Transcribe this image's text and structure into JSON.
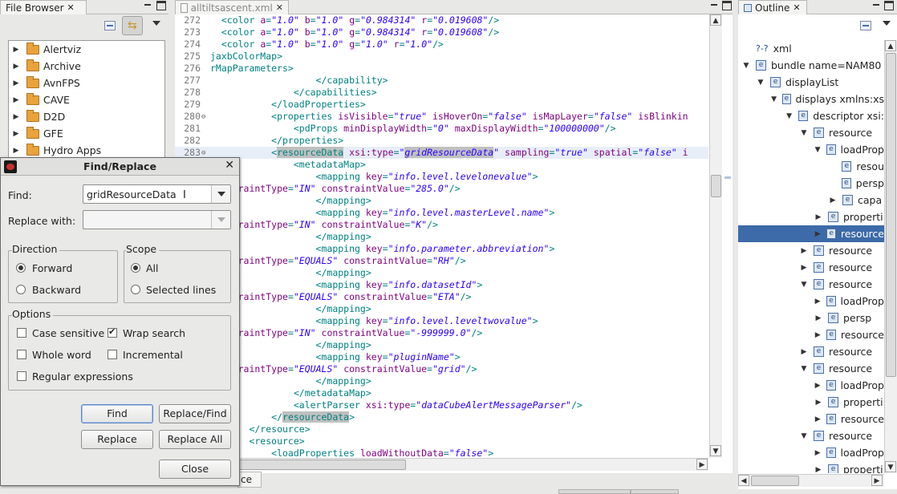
{
  "file_browser": {
    "tab_label": "File Browser",
    "items": [
      {
        "label": "Alertviz"
      },
      {
        "label": "Archive"
      },
      {
        "label": "AvnFPS"
      },
      {
        "label": "CAVE"
      },
      {
        "label": "D2D"
      },
      {
        "label": "GFE"
      },
      {
        "label": "Hydro Apps"
      }
    ]
  },
  "editor": {
    "tab_label": "alltiltsascent.xml",
    "lines": [
      {
        "n": "272",
        "html": "  &lt;color <span class='at'>a</span>=<span class='vl'>\"1.0\"</span> <span class='at'>b</span>=<span class='vl'>\"1.0\"</span> <span class='at'>g</span>=<span class='vl'>\"0.984314\"</span> <span class='at'>r</span>=<span class='vl'>\"0.019608\"</span>/&gt;"
      },
      {
        "n": "273",
        "html": "  &lt;color <span class='at'>a</span>=<span class='vl'>\"1.0\"</span> <span class='at'>b</span>=<span class='vl'>\"1.0\"</span> <span class='at'>g</span>=<span class='vl'>\"0.984314\"</span> <span class='at'>r</span>=<span class='vl'>\"0.019608\"</span>/&gt;"
      },
      {
        "n": "274",
        "html": "  &lt;color <span class='at'>a</span>=<span class='vl'>\"1.0\"</span> <span class='at'>b</span>=<span class='vl'>\"1.0\"</span> <span class='at'>g</span>=<span class='vl'>\"1.0\"</span> <span class='at'>r</span>=<span class='vl'>\"1.0\"</span>/&gt;"
      },
      {
        "n": "275",
        "html": "jaxbColorMap&gt;"
      },
      {
        "n": "276",
        "html": "rMapParameters&gt;"
      },
      {
        "n": "277",
        "html": "                   &lt;/capability&gt;"
      },
      {
        "n": "278",
        "html": "               &lt;/capabilities&gt;"
      },
      {
        "n": "279",
        "html": "           &lt;/loadProperties&gt;"
      },
      {
        "n": "280",
        "html": "           &lt;properties <span class='at'>isVisible</span>=<span class='vl'>\"true\"</span> <span class='at'>isHoverOn</span>=<span class='vl'>\"false\"</span> <span class='at'>isMapLayer</span>=<span class='vl'>\"false\"</span> <span class='at'>isBlinkin</span>"
      },
      {
        "n": "281",
        "html": "               &lt;pdProps <span class='at'>minDisplayWidth</span>=<span class='vl'>\"0\"</span> <span class='at'>maxDisplayWidth</span>=<span class='vl'>\"100000000\"</span>/&gt;"
      },
      {
        "n": "282",
        "html": "           &lt;/properties&gt;"
      },
      {
        "n": "283",
        "html": "           &lt;<span class='hl'>resourceData</span> <span class='at'>xsi:type</span>=<span class='vl'>\"<span class='hl'>gridResourceData</span>\"</span> <span class='at'>sampling</span>=<span class='vl'>\"true\"</span> <span class='at'>spatial</span>=<span class='vl'>\"false\"</span> <span class='at'>i</span>"
      },
      {
        "n": "",
        "html": "               &lt;metadataMap&gt;"
      },
      {
        "n": "",
        "html": "                   &lt;mapping <span class='at'>key</span>=<span class='vl'>\"info.level.levelonevalue\"</span>&gt;"
      },
      {
        "n": "",
        "html": "<span class='at'>constraintType</span>=<span class='vl'>\"IN\"</span> <span class='at'>constraintValue</span>=<span class='vl'>\"285.0\"</span>/&gt;"
      },
      {
        "n": "",
        "html": "                   &lt;/mapping&gt;"
      },
      {
        "n": "",
        "html": "                   &lt;mapping <span class='at'>key</span>=<span class='vl'>\"info.level.masterLevel.name\"</span>&gt;"
      },
      {
        "n": "",
        "html": "<span class='at'>constraintType</span>=<span class='vl'>\"IN\"</span> <span class='at'>constraintValue</span>=<span class='vl'>\"K\"</span>/&gt;"
      },
      {
        "n": "",
        "html": "                   &lt;/mapping&gt;"
      },
      {
        "n": "",
        "html": "                   &lt;mapping <span class='at'>key</span>=<span class='vl'>\"info.parameter.abbreviation\"</span>&gt;"
      },
      {
        "n": "",
        "html": "<span class='at'>constraintType</span>=<span class='vl'>\"EQUALS\"</span> <span class='at'>constraintValue</span>=<span class='vl'>\"RH\"</span>/&gt;"
      },
      {
        "n": "",
        "html": "                   &lt;/mapping&gt;"
      },
      {
        "n": "",
        "html": "                   &lt;mapping <span class='at'>key</span>=<span class='vl'>\"info.datasetId\"</span>&gt;"
      },
      {
        "n": "",
        "html": "<span class='at'>constraintType</span>=<span class='vl'>\"EQUALS\"</span> <span class='at'>constraintValue</span>=<span class='vl'>\"ETA\"</span>/&gt;"
      },
      {
        "n": "",
        "html": "                   &lt;/mapping&gt;"
      },
      {
        "n": "",
        "html": "                   &lt;mapping <span class='at'>key</span>=<span class='vl'>\"info.level.leveltwovalue\"</span>&gt;"
      },
      {
        "n": "",
        "html": "<span class='at'>constraintType</span>=<span class='vl'>\"IN\"</span> <span class='at'>constraintValue</span>=<span class='vl'>\"-999999.0\"</span>/&gt;"
      },
      {
        "n": "",
        "html": "                   &lt;/mapping&gt;"
      },
      {
        "n": "",
        "html": "                   &lt;mapping <span class='at'>key</span>=<span class='vl'>\"pluginName\"</span>&gt;"
      },
      {
        "n": "",
        "html": "<span class='at'>constraintType</span>=<span class='vl'>\"EQUALS\"</span> <span class='at'>constraintValue</span>=<span class='vl'>\"grid\"</span>/&gt;"
      },
      {
        "n": "",
        "html": "                   &lt;/mapping&gt;"
      },
      {
        "n": "",
        "html": "               &lt;/metadataMap&gt;"
      },
      {
        "n": "",
        "html": "               &lt;alertParser <span class='at'>xsi:type</span>=<span class='vl'>\"dataCubeAlertMessageParser\"</span>/&gt;"
      },
      {
        "n": "",
        "html": "           &lt;/<span class='hl'>resourceData</span>&gt;"
      },
      {
        "n": "",
        "html": "       &lt;/resource&gt;"
      },
      {
        "n": "",
        "html": "       &lt;resource&gt;"
      },
      {
        "n": "",
        "html": "           &lt;loadProperties <span class='at'>loadWithoutData</span>=<span class='vl'>\"false\"</span>&gt;"
      }
    ],
    "bottom_tab_fragment": "ce"
  },
  "outline": {
    "tab_label": "Outline",
    "items": [
      {
        "label": "xml",
        "depth": 0,
        "arrow": "",
        "icon": "?-?"
      },
      {
        "label": "bundle name=NAM80",
        "depth": 0,
        "arrow": "▼",
        "icon": "e"
      },
      {
        "label": "displayList",
        "depth": 1,
        "arrow": "▼",
        "icon": "e"
      },
      {
        "label": "displays xmlns:xs",
        "depth": 2,
        "arrow": "▼",
        "icon": "e"
      },
      {
        "label": "descriptor xsi:",
        "depth": 3,
        "arrow": "▼",
        "icon": "e"
      },
      {
        "label": "resource",
        "depth": 4,
        "arrow": "▼",
        "icon": "e"
      },
      {
        "label": "loadProp",
        "depth": 5,
        "arrow": "▼",
        "icon": "e"
      },
      {
        "label": "resou",
        "depth": 6,
        "arrow": "",
        "icon": "e"
      },
      {
        "label": "persp",
        "depth": 6,
        "arrow": "",
        "icon": "e"
      },
      {
        "label": "capa",
        "depth": 6,
        "arrow": "▶",
        "icon": "e"
      },
      {
        "label": "properti",
        "depth": 5,
        "arrow": "▶",
        "icon": "e"
      },
      {
        "label": "resource",
        "depth": 5,
        "arrow": "▶",
        "icon": "e",
        "selected": true
      },
      {
        "label": "resource",
        "depth": 4,
        "arrow": "▶",
        "icon": "e"
      },
      {
        "label": "resource",
        "depth": 4,
        "arrow": "▶",
        "icon": "e"
      },
      {
        "label": "resource",
        "depth": 4,
        "arrow": "▼",
        "icon": "e"
      },
      {
        "label": "loadProp",
        "depth": 5,
        "arrow": "▶",
        "icon": "e"
      },
      {
        "label": "persp",
        "depth": 5,
        "arrow": "▶",
        "icon": "e"
      },
      {
        "label": "resource",
        "depth": 5,
        "arrow": "▶",
        "icon": "e"
      },
      {
        "label": "resource",
        "depth": 4,
        "arrow": "▶",
        "icon": "e"
      },
      {
        "label": "resource",
        "depth": 4,
        "arrow": "▼",
        "icon": "e"
      },
      {
        "label": "loadProp",
        "depth": 5,
        "arrow": "▶",
        "icon": "e"
      },
      {
        "label": "properti",
        "depth": 5,
        "arrow": "▶",
        "icon": "e"
      },
      {
        "label": "resource",
        "depth": 5,
        "arrow": "▶",
        "icon": "e"
      },
      {
        "label": "resource",
        "depth": 4,
        "arrow": "▼",
        "icon": "e"
      },
      {
        "label": "loadProp",
        "depth": 5,
        "arrow": "▶",
        "icon": "e"
      },
      {
        "label": "properti",
        "depth": 5,
        "arrow": "▶",
        "icon": "e"
      }
    ]
  },
  "dialog": {
    "title": "Find/Replace",
    "find_label": "Find:",
    "find_value": "gridResourceData",
    "replace_label": "Replace with:",
    "replace_value": "",
    "direction_label": "Direction",
    "forward_label": "Forward",
    "backward_label": "Backward",
    "scope_label": "Scope",
    "all_label": "All",
    "selected_lines_label": "Selected lines",
    "options_label": "Options",
    "case_sensitive_label": "Case sensitive",
    "wrap_search_label": "Wrap search",
    "whole_word_label": "Whole word",
    "incremental_label": "Incremental",
    "regex_label": "Regular expressions",
    "find_button": "Find",
    "replace_find_button": "Replace/Find",
    "replace_button": "Replace",
    "replace_all_button": "Replace All",
    "close_button": "Close"
  }
}
